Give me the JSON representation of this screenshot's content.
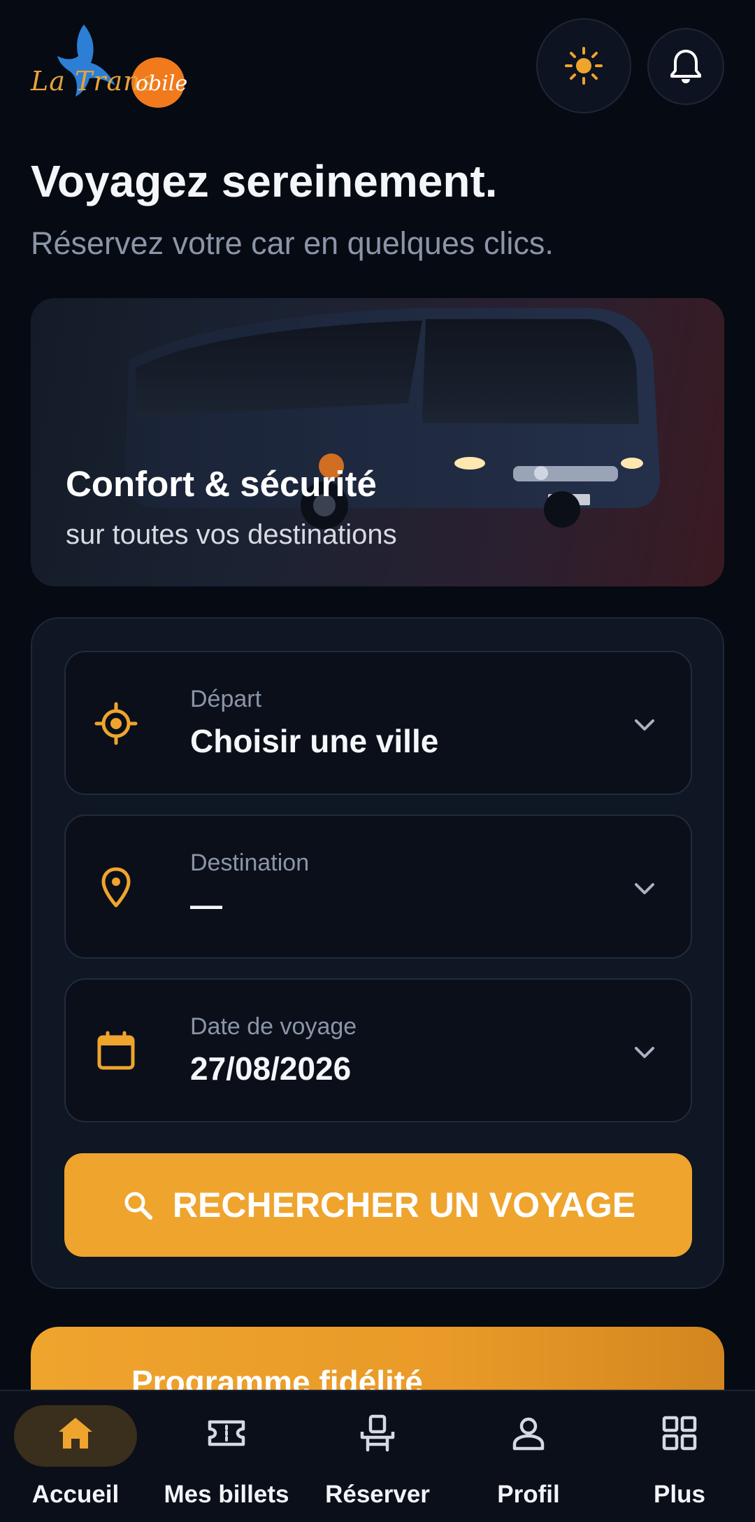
{
  "brand": {
    "logo_text": "La Transmobile",
    "accent": "#efa42e"
  },
  "header": {
    "theme_icon": "sun-icon",
    "notifications_icon": "bell-icon"
  },
  "hero_text": {
    "title": "Voyagez sereinement.",
    "subtitle": "Réservez votre car en quelques clics."
  },
  "banner": {
    "title": "Confort & sécurité",
    "subtitle": "sur toutes vos destinations"
  },
  "form": {
    "departure": {
      "label": "Départ",
      "value": "Choisir une ville",
      "icon": "crosshair-icon"
    },
    "destination": {
      "label": "Destination",
      "value": "—",
      "icon": "map-pin-icon"
    },
    "date": {
      "label": "Date de voyage",
      "value": "27/08/2026",
      "icon": "calendar-icon"
    },
    "search_button": "RECHERCHER UN VOYAGE"
  },
  "loyalty": {
    "title": "Programme fidélité"
  },
  "nav": {
    "items": [
      {
        "label": "Accueil",
        "icon": "home-icon",
        "active": true
      },
      {
        "label": "Mes billets",
        "icon": "ticket-icon",
        "active": false
      },
      {
        "label": "Réserver",
        "icon": "seat-icon",
        "active": false
      },
      {
        "label": "Profil",
        "icon": "user-icon",
        "active": false
      },
      {
        "label": "Plus",
        "icon": "grid-icon",
        "active": false
      }
    ]
  }
}
